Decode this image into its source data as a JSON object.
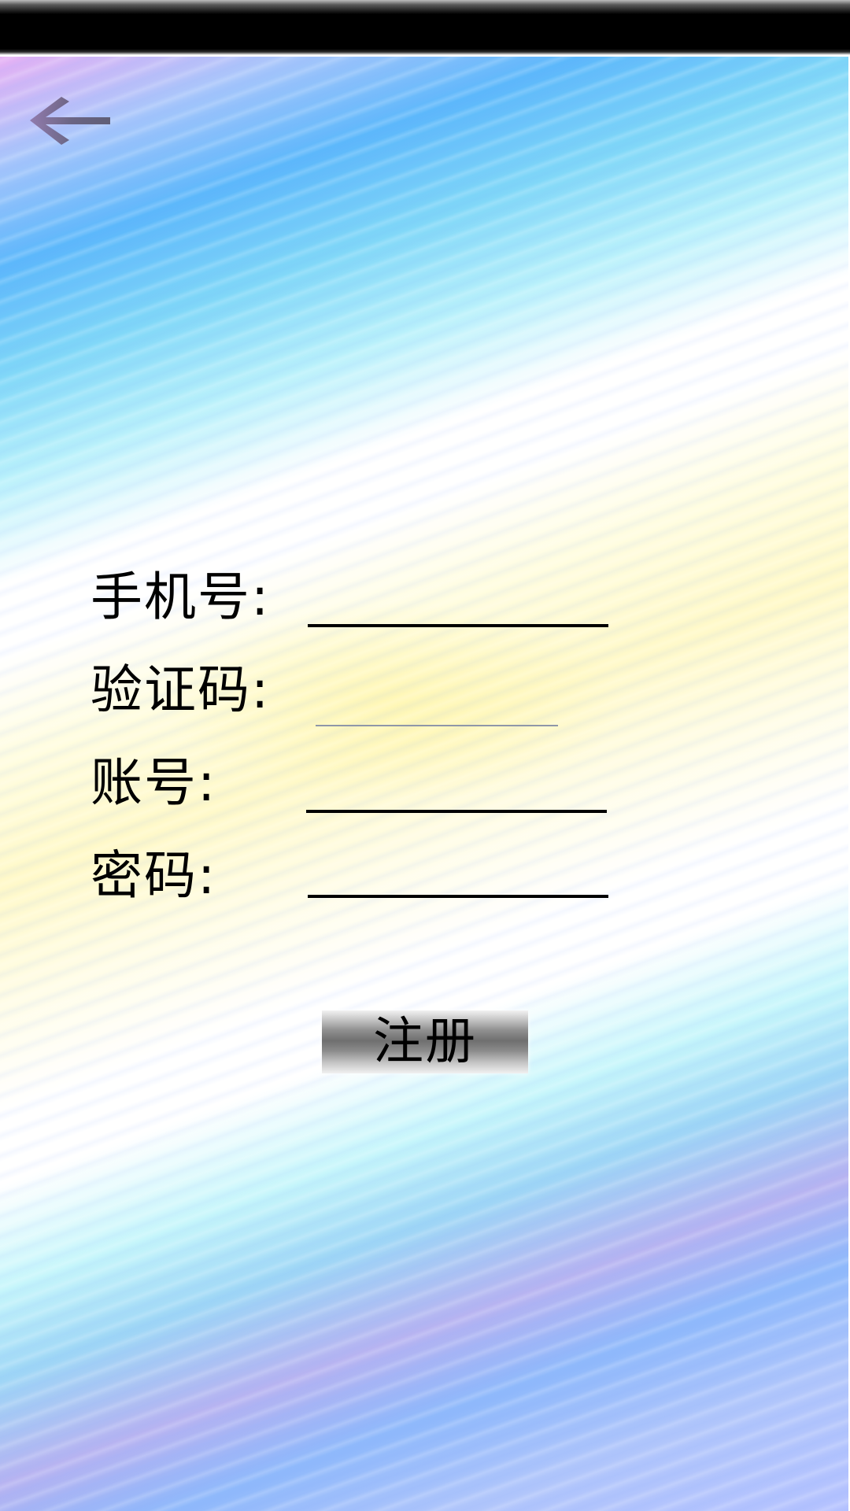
{
  "header": {
    "back_icon": "arrow-left-icon"
  },
  "form": {
    "phone_label": "手机号:",
    "phone_value": "",
    "code_label": "验证码:",
    "code_value": "",
    "account_label": "账号:",
    "account_value": "",
    "password_label": "密码:",
    "password_value": ""
  },
  "actions": {
    "register_label": "注册"
  },
  "colors": {
    "status_bar": "#000000",
    "text": "#000000",
    "accent_blue": "#5cb8fb",
    "accent_pink": "#e7b0f4",
    "accent_yellow": "#fff9c8"
  }
}
